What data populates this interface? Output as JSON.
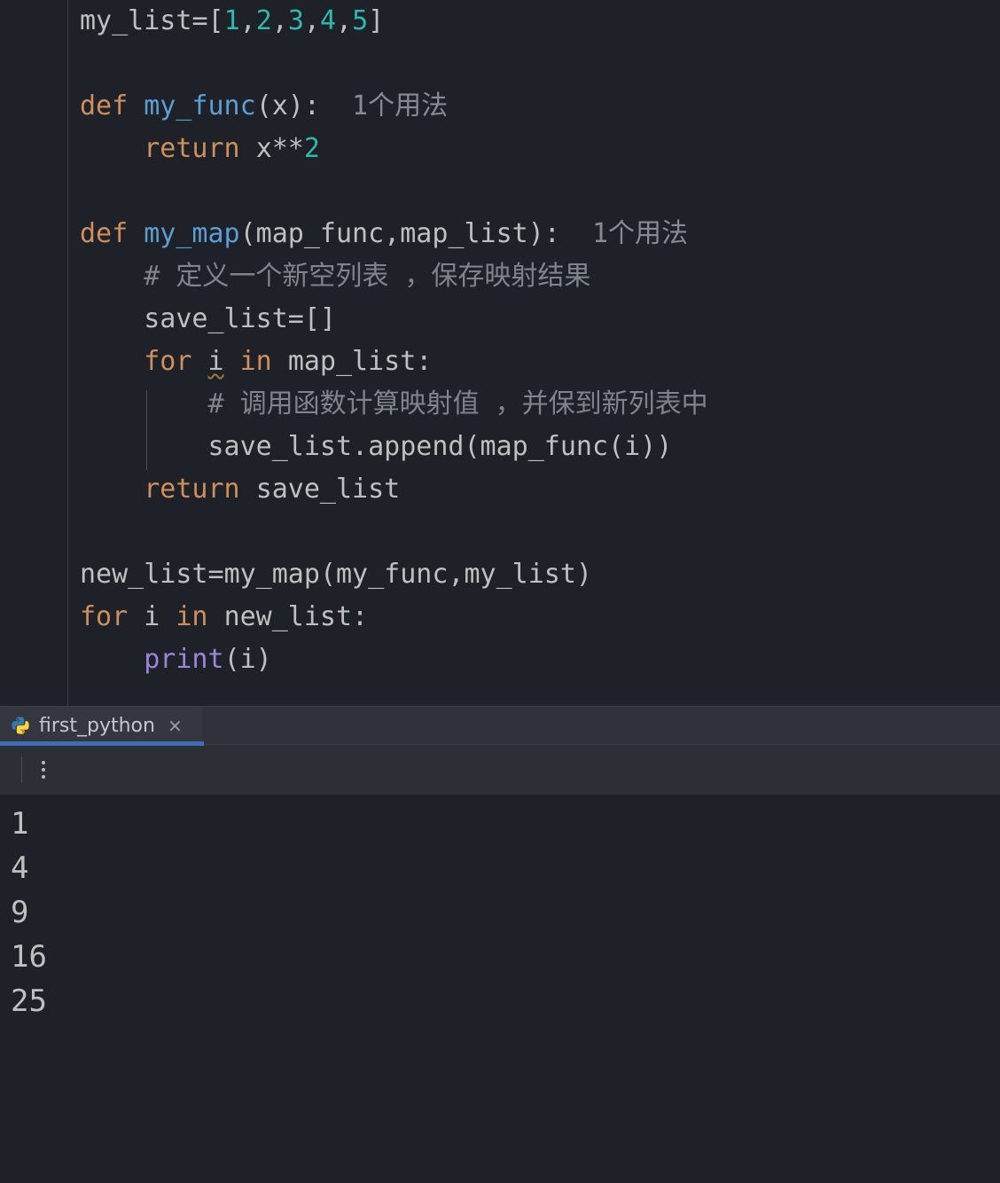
{
  "editor": {
    "language": "python",
    "usage_hint_label": "1个用法",
    "code": {
      "line1": {
        "var": "my_list",
        "assign": "=",
        "lb": "[",
        "n1": "1",
        "c1": ",",
        "n2": "2",
        "c2": ",",
        "n3": "3",
        "c3": ",",
        "n4": "4",
        "c4": ",",
        "n5": "5",
        "rb": "]"
      },
      "blank1": "",
      "def1": {
        "kw_def": "def ",
        "name": "my_func",
        "args": "(x):",
        "hint": "  1个用法"
      },
      "ret1": {
        "indent": "    ",
        "kw_return": "return ",
        "expr": "x**",
        "num2": "2"
      },
      "blank2": "",
      "def2": {
        "kw_def": "def ",
        "name": "my_map",
        "args": "(map_func,map_list):",
        "hint": "  1个用法"
      },
      "cmt1": {
        "indent": "    ",
        "text": "# 定义一个新空列表 ，保存映射结果"
      },
      "save_init": {
        "indent": "    ",
        "text": "save_list=[]"
      },
      "forloop": {
        "indent": "    ",
        "kw_for": "for ",
        "var_i": "i",
        "kw_in": " in ",
        "rest": "map_list:"
      },
      "cmt2": {
        "indent": "        ",
        "text": "# 调用函数计算映射值 ，并保到新列表中"
      },
      "append_line": {
        "indent": "        ",
        "text": "save_list.append(map_func(i))"
      },
      "ret2": {
        "indent": "    ",
        "kw_return": "return ",
        "expr": "save_list"
      },
      "blank3": "",
      "assign2": {
        "var": "new_list",
        "eq": "=",
        "call": "my_map",
        "args": "(my_func,my_list)"
      },
      "forloop2": {
        "kw_for": "for ",
        "var_i": "i",
        "kw_in": " in ",
        "rest": "new_list:"
      },
      "print_line": {
        "indent": "    ",
        "fn": "print",
        "args": "(i)"
      }
    }
  },
  "tabs": {
    "active_label": "first_python"
  },
  "console": {
    "output": [
      "1",
      "4",
      "9",
      "16",
      "25"
    ]
  }
}
